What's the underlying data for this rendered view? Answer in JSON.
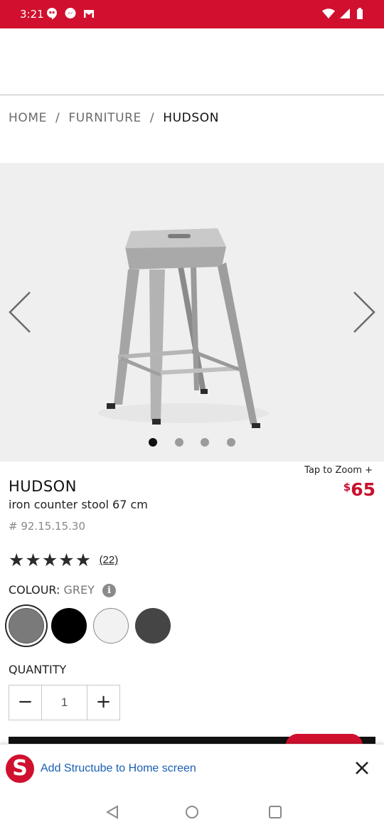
{
  "status_bar": {
    "time": "3:21",
    "color": "#d0102e",
    "icons": [
      "hangouts-icon",
      "messenger-icon",
      "gmail-icon",
      "wifi-icon",
      "signal-icon",
      "battery-icon"
    ]
  },
  "breadcrumb": {
    "items": [
      "HOME",
      "FURNITURE",
      "HUDSON"
    ],
    "separator": "/"
  },
  "gallery": {
    "image": "grey-metal-counter-stool",
    "prev_icon": "chevron-left-icon",
    "next_icon": "chevron-right-icon",
    "dots_total": 4,
    "active_dot": 1
  },
  "product": {
    "zoom_label": "Tap to Zoom +",
    "name": "HUDSON",
    "description": "iron counter stool 67 cm",
    "sku": "# 92.15.15.30",
    "price_currency": "$",
    "price_amount": "65",
    "price_color": "#c8102e",
    "rating_stars": 5,
    "review_count": "(22)"
  },
  "colour": {
    "label": "COLOUR:",
    "selected": "GREY",
    "info_icon": "info-icon",
    "swatches": [
      {
        "name": "grey",
        "color": "#7a7a7a",
        "selected": true
      },
      {
        "name": "black",
        "color": "#000000",
        "selected": false
      },
      {
        "name": "white",
        "color": "#f2f2f2",
        "selected": false
      },
      {
        "name": "charcoal",
        "color": "#454545",
        "selected": false
      }
    ]
  },
  "quantity": {
    "label": "QUANTITY",
    "minus": "−",
    "value": "1",
    "plus": "+"
  },
  "add_to_home": {
    "logo_letter": "S",
    "text": "Add Structube to Home screen",
    "close_icon": "close-icon"
  },
  "nav": {
    "back_icon": "back-triangle-icon",
    "home_icon": "home-circle-icon",
    "recents_icon": "recents-square-icon"
  }
}
